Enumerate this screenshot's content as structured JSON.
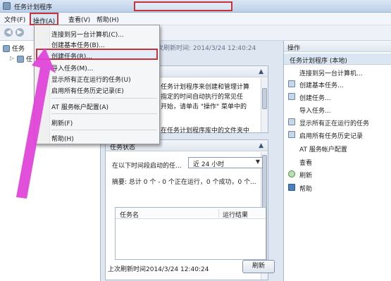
{
  "window": {
    "title": "任务计划程序"
  },
  "menubar": {
    "file": "文件(F)",
    "action": "操作(A)",
    "view": "查看(V)",
    "help": "帮助(H)"
  },
  "tree": {
    "root": "任务",
    "child": "任"
  },
  "center": {
    "top_info": "次刷新时间: 2014/3/24 12:40:24",
    "overview_text": [
      "任务计划程序来创建和管理计算",
      "指定的时间自动执行的常见任",
      "开始，请单击 \"操作\" 菜单中的",
      "在任务计划程序库中的文件夹中"
    ],
    "status_header": "任务状态",
    "filter_label": "在以下时间段启动的任...",
    "filter_value": "近 24 小时",
    "summary": "摘要: 总计 0 个 - 0 个正在运行，0 个成功，0 个...",
    "table_headers": [
      "任务名",
      "运行结果"
    ],
    "last_refresh": "上次刷新时间2014/3/24 12:40:24",
    "refresh_button": "刷新"
  },
  "actions": {
    "header": "操作",
    "subheader": "任务计划程序 (本地)",
    "items": [
      "连接到另一台计算机...",
      "创建基本任务...",
      "创建任务...",
      "导入任务...",
      "显示所有正在运行的任务",
      "启用所有任务历史记录",
      "AT 服务帐户配置",
      "查看",
      "刷新",
      "帮助"
    ]
  },
  "context_menu": {
    "items": [
      "连接到另一台计算机(C)...",
      "创建基本任务(B)...",
      "创建任务(R)...",
      "导入任务(M)...",
      "显示所有正在运行的任务(U)",
      "启用所有任务历史记录(E)",
      "AT 服务帐户配置(A)",
      "刷新(F)",
      "帮助(H)"
    ],
    "highlighted_item": "创建任务(R)..."
  },
  "colors": {
    "highlight_box": "#c8333a",
    "annotation_arrow": "#e040d8"
  }
}
